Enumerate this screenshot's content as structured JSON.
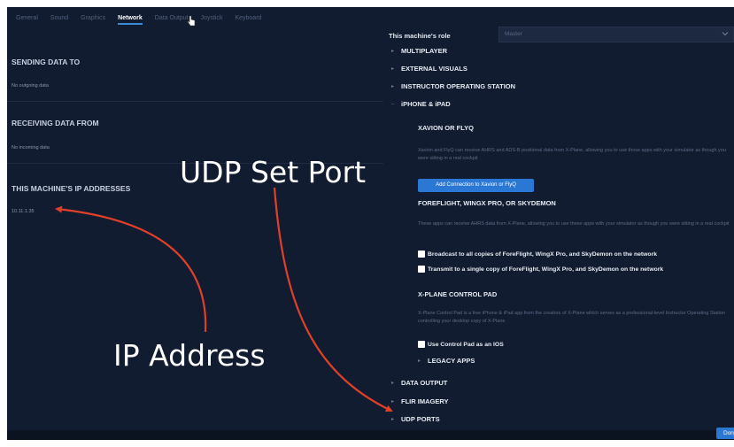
{
  "tabs": [
    "General",
    "Sound",
    "Graphics",
    "Network",
    "Data Output",
    "Joystick",
    "Keyboard"
  ],
  "active_tab": "Network",
  "left": {
    "sending_title": "SENDING DATA TO",
    "sending_value": "No outgoing data",
    "receiving_title": "RECEIVING DATA FROM",
    "receiving_value": "No incoming data",
    "ip_title": "THIS MACHINE'S IP ADDRESSES",
    "ip_value": "10.11.1.35"
  },
  "role": {
    "label": "This machine's role",
    "value": "Master"
  },
  "sections": {
    "multiplayer": "MULTIPLAYER",
    "external_visuals": "EXTERNAL VISUALS",
    "ios": "INSTRUCTOR OPERATING STATION",
    "iphone_ipad": "iPHONE & iPAD",
    "data_output": "DATA OUTPUT",
    "flir": "FLIR IMAGERY",
    "udp_ports": "UDP PORTS"
  },
  "xavion": {
    "title": "XAVION OR FLYQ",
    "desc": "Xavion and FlyQ can receive AHRS and ADS-B positional data from X-Plane, allowing you to use those apps with your simulator as though you were sitting in a real cockpit",
    "button": "Add Connection to Xavion or FlyQ"
  },
  "foreflight": {
    "title": "FOREFLIGHT, WINGX PRO, OR SKYDEMON",
    "desc": "These apps can receive AHRS data from X-Plane, allowing you to use these apps with your simulator as though you were sitting in a real cockpit",
    "broadcast": "Broadcast to all copies of ForeFlight, WingX Pro, and SkyDemon on the network",
    "transmit": "Transmit to a single copy of ForeFlight, WingX Pro, and SkyDemon on the network"
  },
  "controlpad": {
    "title": "X-PLANE CONTROL PAD",
    "desc": "X-Plane Control Pad is a free iPhone & iPad app from the creators of X-Plane which serves as a professional-level Instructor Operating Station controlling your desktop copy of X-Plane",
    "use_ios": "Use Control Pad as an IOS",
    "legacy": "LEGACY APPS"
  },
  "done_button": "Done",
  "annotations": {
    "udp_set_port": "UDP Set Port",
    "ip_address": "IP Address",
    "arrow_color": "#e0402a"
  },
  "colors": {
    "background": "#121c30",
    "accent": "#2a78d4"
  }
}
